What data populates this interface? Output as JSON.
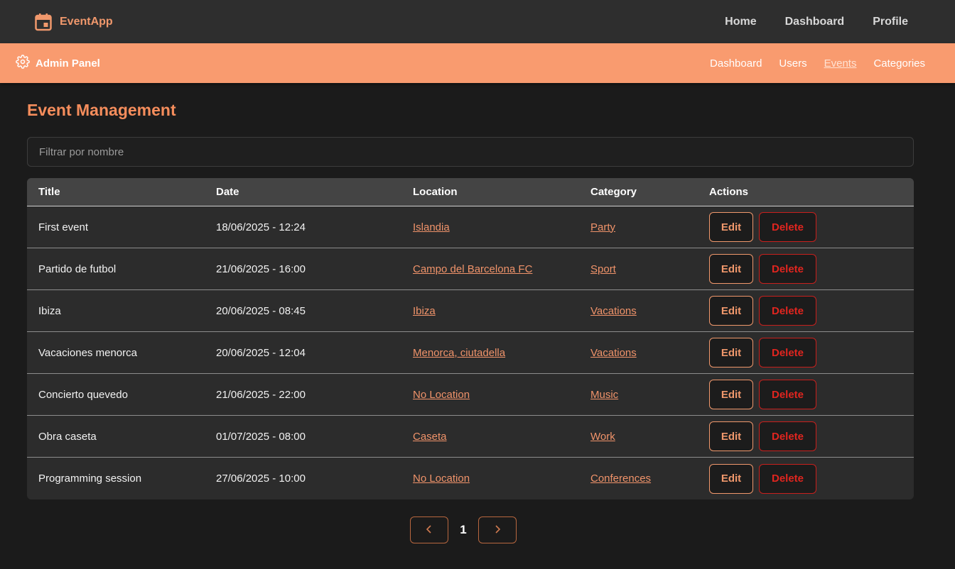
{
  "app": {
    "name": "EventApp"
  },
  "topnav": {
    "home": "Home",
    "dashboard": "Dashboard",
    "profile": "Profile"
  },
  "admin": {
    "title": "Admin Panel",
    "nav": {
      "dashboard": "Dashboard",
      "users": "Users",
      "events": "Events",
      "categories": "Categories"
    },
    "active": "Events"
  },
  "page": {
    "title": "Event Management"
  },
  "filter": {
    "placeholder": "Filtrar por nombre",
    "value": ""
  },
  "table": {
    "headers": {
      "title": "Title",
      "date": "Date",
      "location": "Location",
      "category": "Category",
      "actions": "Actions"
    },
    "edit_label": "Edit",
    "delete_label": "Delete",
    "rows": [
      {
        "title": "First event",
        "date": "18/06/2025 - 12:24",
        "location": "Islandia",
        "category": "Party"
      },
      {
        "title": "Partido de futbol",
        "date": "21/06/2025 - 16:00",
        "location": "Campo del Barcelona FC",
        "category": "Sport"
      },
      {
        "title": "Ibiza",
        "date": "20/06/2025 - 08:45",
        "location": "Ibiza",
        "category": "Vacations"
      },
      {
        "title": "Vacaciones menorca",
        "date": "20/06/2025 - 12:04",
        "location": "Menorca, ciutadella",
        "category": "Vacations"
      },
      {
        "title": "Concierto quevedo",
        "date": "21/06/2025 - 22:00",
        "location": "No Location",
        "category": "Music"
      },
      {
        "title": "Obra caseta",
        "date": "01/07/2025 - 08:00",
        "location": "Caseta",
        "category": "Work"
      },
      {
        "title": "Programming session",
        "date": "27/06/2025 - 10:00",
        "location": "No Location",
        "category": "Conferences"
      }
    ]
  },
  "pagination": {
    "current": "1"
  },
  "colors": {
    "accent": "#f99b6f",
    "title": "#f58d5c",
    "link": "#f0936a",
    "delete": "#e0251f",
    "background": "#1b1b1b"
  },
  "icons": {
    "brand": "calendar-icon",
    "admin": "gear-icon",
    "prev": "chevron-left-icon",
    "next": "chevron-right-icon"
  }
}
